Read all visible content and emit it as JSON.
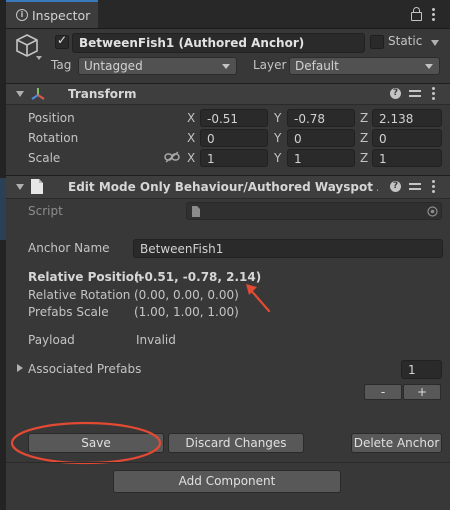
{
  "tab": {
    "label": "Inspector"
  },
  "header": {
    "object_name": "BetweenFish1 (Authored Anchor)",
    "static_label": "Static",
    "tag_label": "Tag",
    "tag_value": "Untagged",
    "layer_label": "Layer",
    "layer_value": "Default",
    "active": true,
    "static": false
  },
  "transform": {
    "title": "Transform",
    "position_label": "Position",
    "rotation_label": "Rotation",
    "scale_label": "Scale",
    "axis_x": "X",
    "axis_y": "Y",
    "axis_z": "Z",
    "position": {
      "x": "-0.51",
      "y": "-0.78",
      "z": "2.138"
    },
    "rotation": {
      "x": "0",
      "y": "0",
      "z": "0"
    },
    "scale": {
      "x": "1",
      "y": "1",
      "z": "1"
    }
  },
  "component": {
    "title": "Edit Mode Only Behaviour/Authored Wayspot Anchor (",
    "script_label": "Script",
    "anchor_name_label": "Anchor Name",
    "anchor_name_value": "BetweenFish1",
    "relative_position_label": "Relative Position",
    "relative_position_value": "(-0.51, -0.78, 2.14)",
    "relative_rotation_label": "Relative Rotation",
    "relative_rotation_value": "(0.00, 0.00, 0.00)",
    "prefabs_scale_label": "Prefabs Scale",
    "prefabs_scale_value": "(1.00, 1.00, 1.00)",
    "payload_label": "Payload",
    "payload_value": "Invalid",
    "associated_prefabs_label": "Associated Prefabs",
    "associated_prefabs_count": "1",
    "minus_label": "-",
    "plus_label": "+",
    "save_label": "Save",
    "discard_label": "Discard Changes",
    "delete_label": "Delete Anchor"
  },
  "add_component_label": "Add Component",
  "colors": {
    "background": "#383838",
    "accent_blue": "#3a79bb",
    "annotation_red": "#e34a33"
  }
}
